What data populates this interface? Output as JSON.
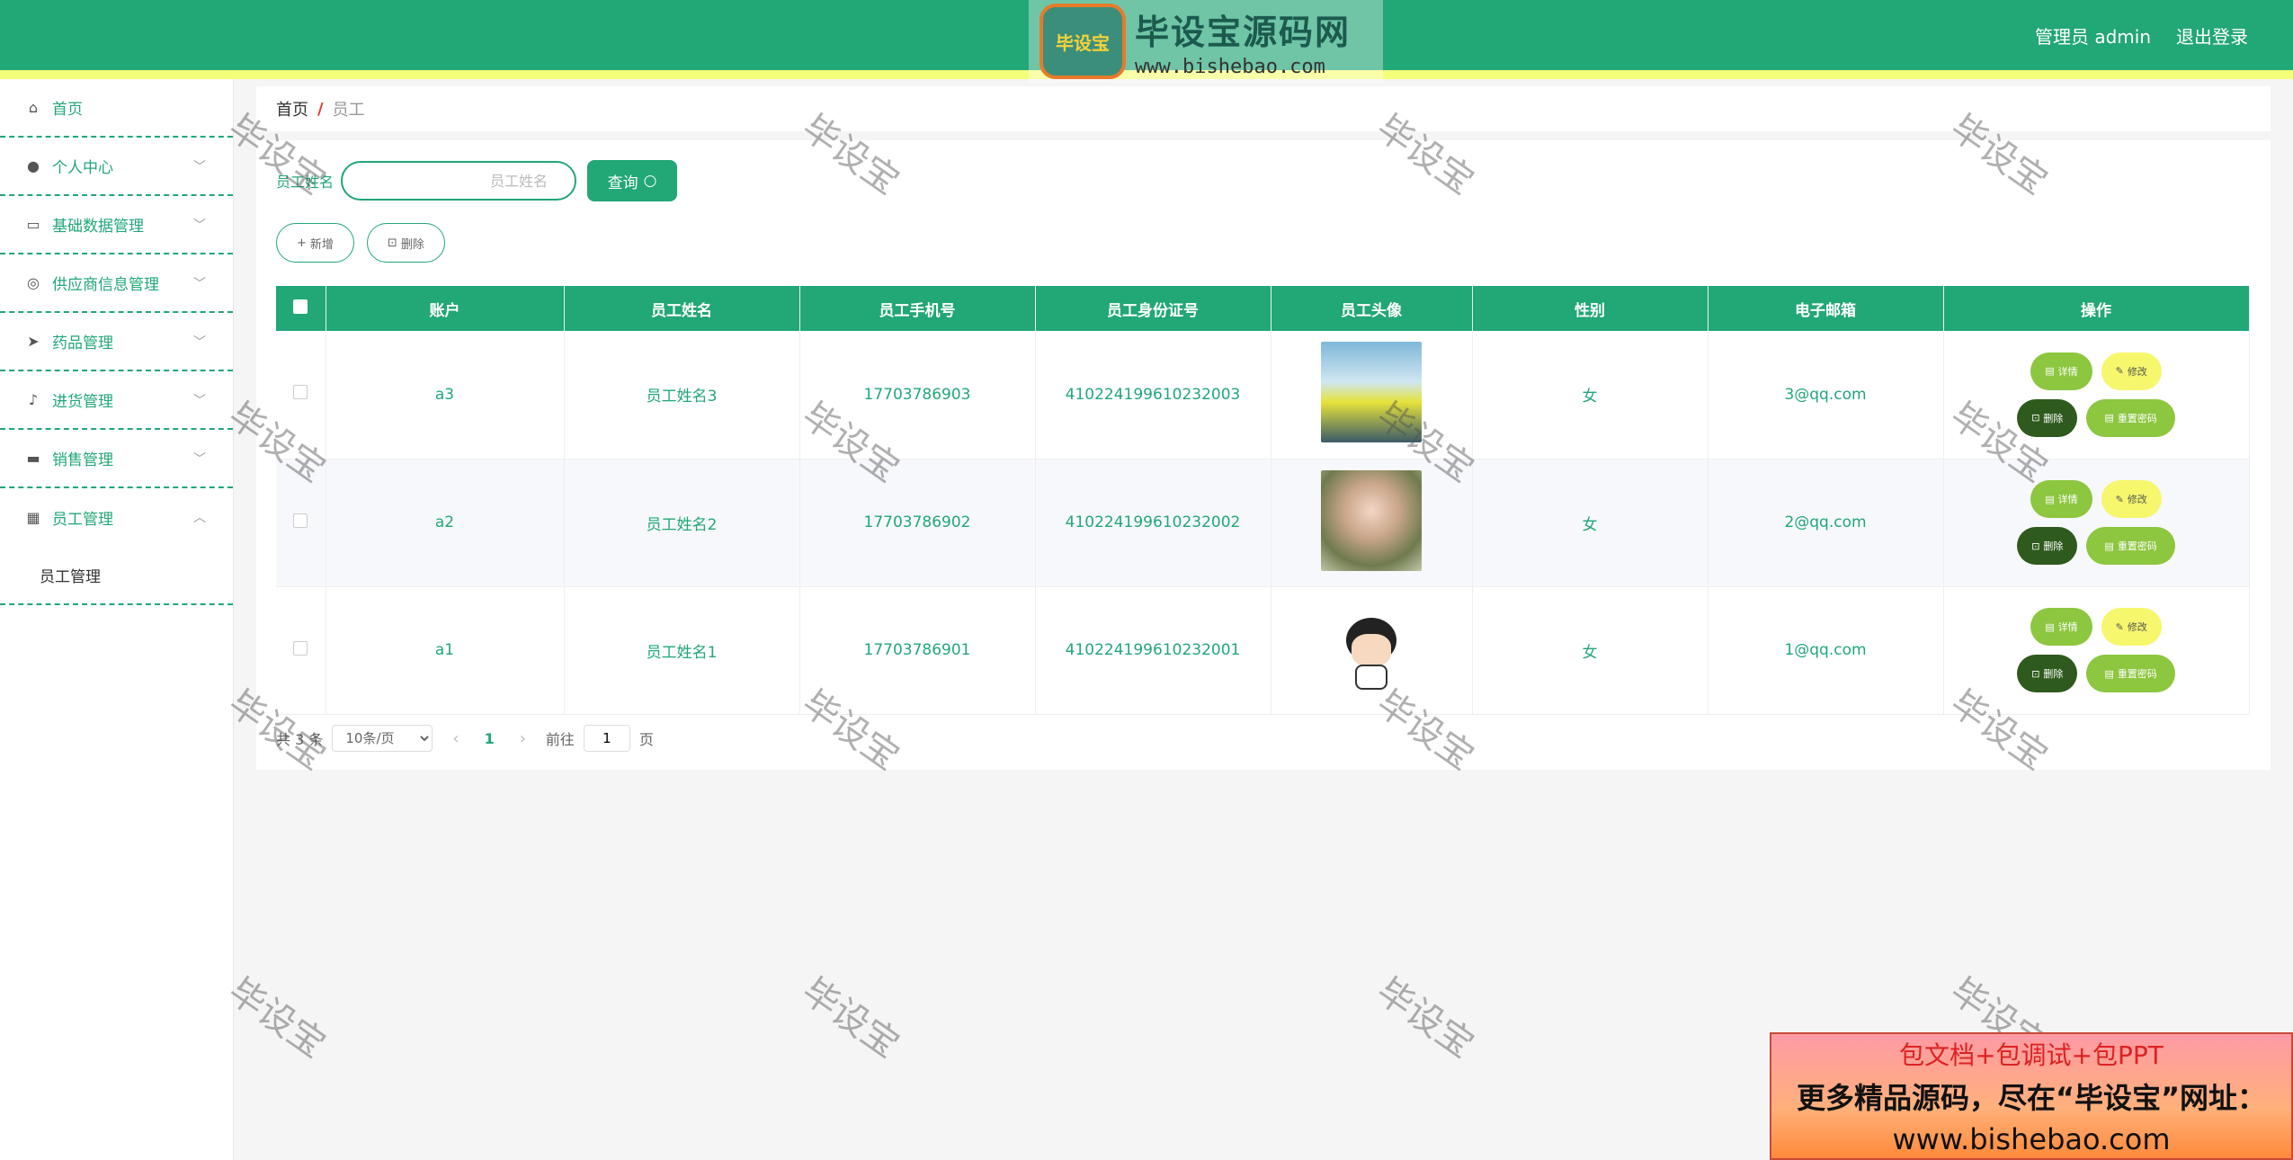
{
  "header": {
    "logo_title": "毕设宝源码网",
    "logo_url": "www.bishebao.com",
    "logo_badge": "毕设宝",
    "user_label": "管理员 admin",
    "logout_label": "退出登录"
  },
  "sidebar": {
    "items": [
      {
        "label": "首页",
        "icon": "home-icon",
        "glyph": "⌂"
      },
      {
        "label": "个人中心",
        "icon": "user-icon",
        "glyph": "●"
      },
      {
        "label": "基础数据管理",
        "icon": "chat-icon",
        "glyph": "▭"
      },
      {
        "label": "供应商信息管理",
        "icon": "compass-icon",
        "glyph": "◎"
      },
      {
        "label": "药品管理",
        "icon": "send-icon",
        "glyph": "➤"
      },
      {
        "label": "进货管理",
        "icon": "mic-icon",
        "glyph": "♪"
      },
      {
        "label": "销售管理",
        "icon": "briefcase-icon",
        "glyph": "▬"
      },
      {
        "label": "员工管理",
        "icon": "grid-icon",
        "glyph": "▦"
      }
    ],
    "subitem": "员工管理"
  },
  "breadcrumb": {
    "home": "首页",
    "sep": "/",
    "current": "员工"
  },
  "search": {
    "label": "员工姓名",
    "placeholder": "员工姓名",
    "button": "查询"
  },
  "actions": {
    "add": "新增",
    "delete": "删除"
  },
  "table": {
    "headers": [
      "账户",
      "员工姓名",
      "员工手机号",
      "员工身份证号",
      "员工头像",
      "性别",
      "电子邮箱",
      "操作"
    ],
    "rows": [
      {
        "account": "a3",
        "name": "员工姓名3",
        "phone": "17703786903",
        "idcard": "410224199610232003",
        "gender": "女",
        "email": "3@qq.com"
      },
      {
        "account": "a2",
        "name": "员工姓名2",
        "phone": "17703786902",
        "idcard": "410224199610232002",
        "gender": "女",
        "email": "2@qq.com"
      },
      {
        "account": "a1",
        "name": "员工姓名1",
        "phone": "17703786901",
        "idcard": "410224199610232001",
        "gender": "女",
        "email": "1@qq.com"
      }
    ],
    "ops": {
      "detail": "详情",
      "edit": "修改",
      "delete": "删除",
      "reset": "重置密码"
    }
  },
  "pager": {
    "total": "共 3 条",
    "page_size": "10条/页",
    "current_page": "1",
    "goto_prefix": "前往",
    "goto_value": "1",
    "goto_suffix": "页"
  },
  "watermark": "毕设宝",
  "ad": {
    "line1": "包文档+包调试+包PPT",
    "line2": "更多精品源码，尽在“毕设宝”网址：",
    "line3": "www.bishebao.com"
  },
  "colors": {
    "primary": "#22a777",
    "stripe": "#f4ff7a",
    "op_detail": "#8dc63f",
    "op_edit": "#f6f76d",
    "op_delete": "#2f5a1e"
  }
}
